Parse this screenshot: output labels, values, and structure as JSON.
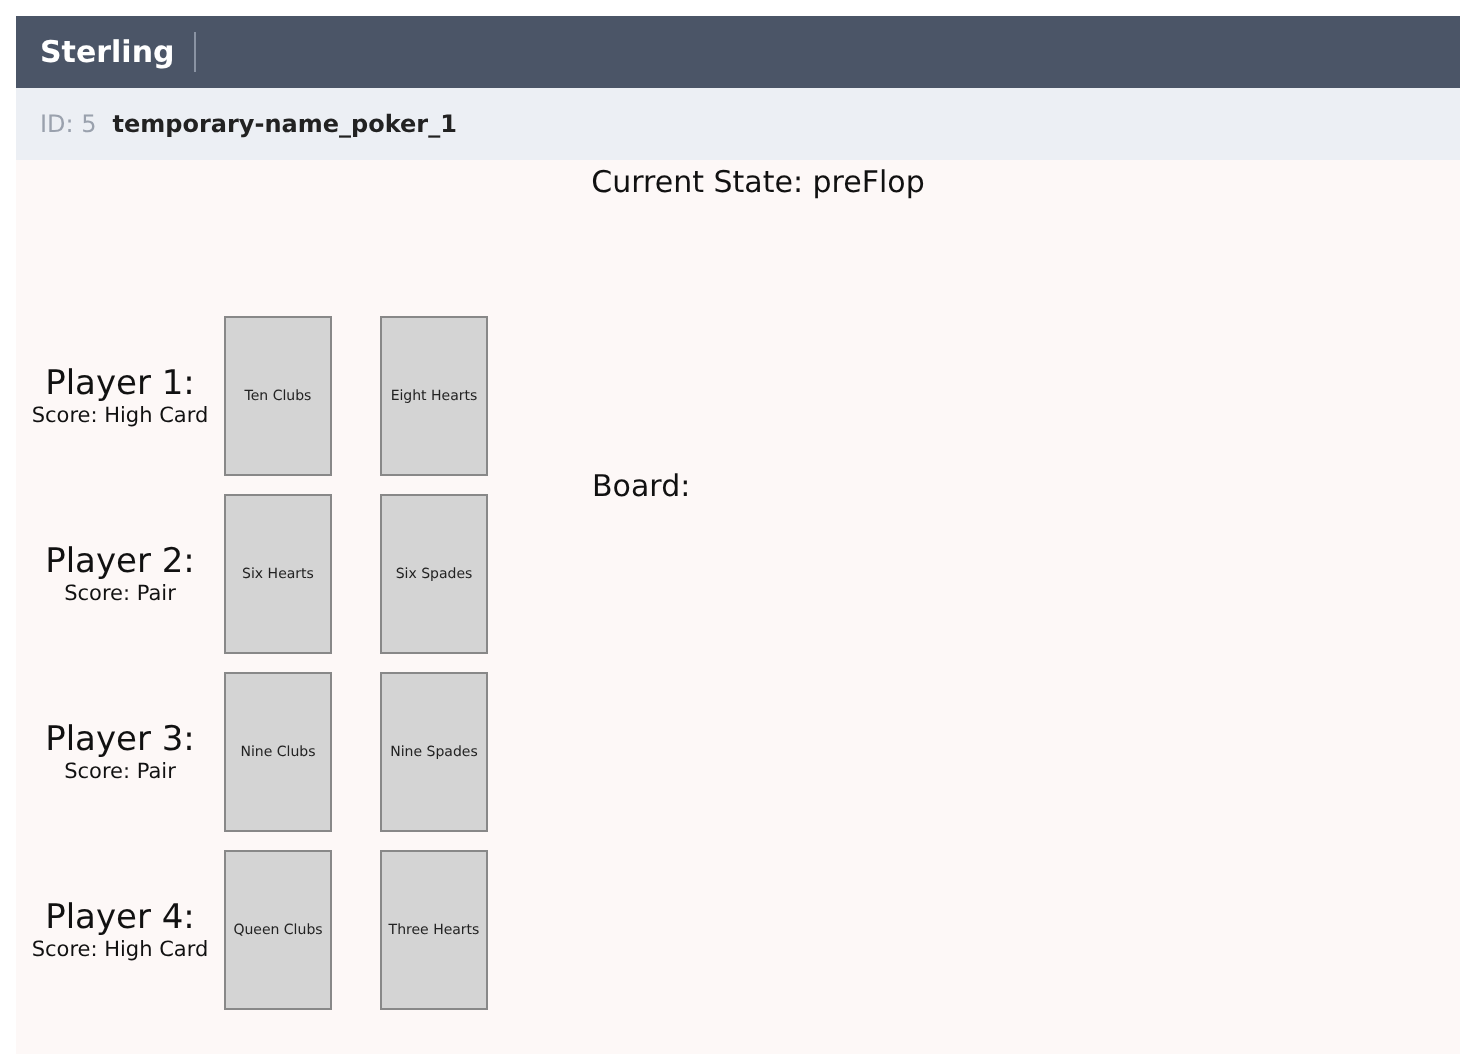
{
  "navbar": {
    "title": "Sterling"
  },
  "instance": {
    "id_label": "ID: 5",
    "name": "temporary-name_poker_1"
  },
  "state_title": "Current State: preFlop",
  "players": [
    {
      "name": "Player 1:",
      "score": "Score: High Card",
      "cards": [
        "Ten Clubs",
        "Eight Hearts"
      ]
    },
    {
      "name": "Player 2:",
      "score": "Score: Pair",
      "cards": [
        "Six Hearts",
        "Six Spades"
      ]
    },
    {
      "name": "Player 3:",
      "score": "Score: Pair",
      "cards": [
        "Nine Clubs",
        "Nine Spades"
      ]
    },
    {
      "name": "Player 4:",
      "score": "Score: High Card",
      "cards": [
        "Queen Clubs",
        "Three Hearts"
      ]
    }
  ],
  "board": {
    "label": "Board:"
  }
}
